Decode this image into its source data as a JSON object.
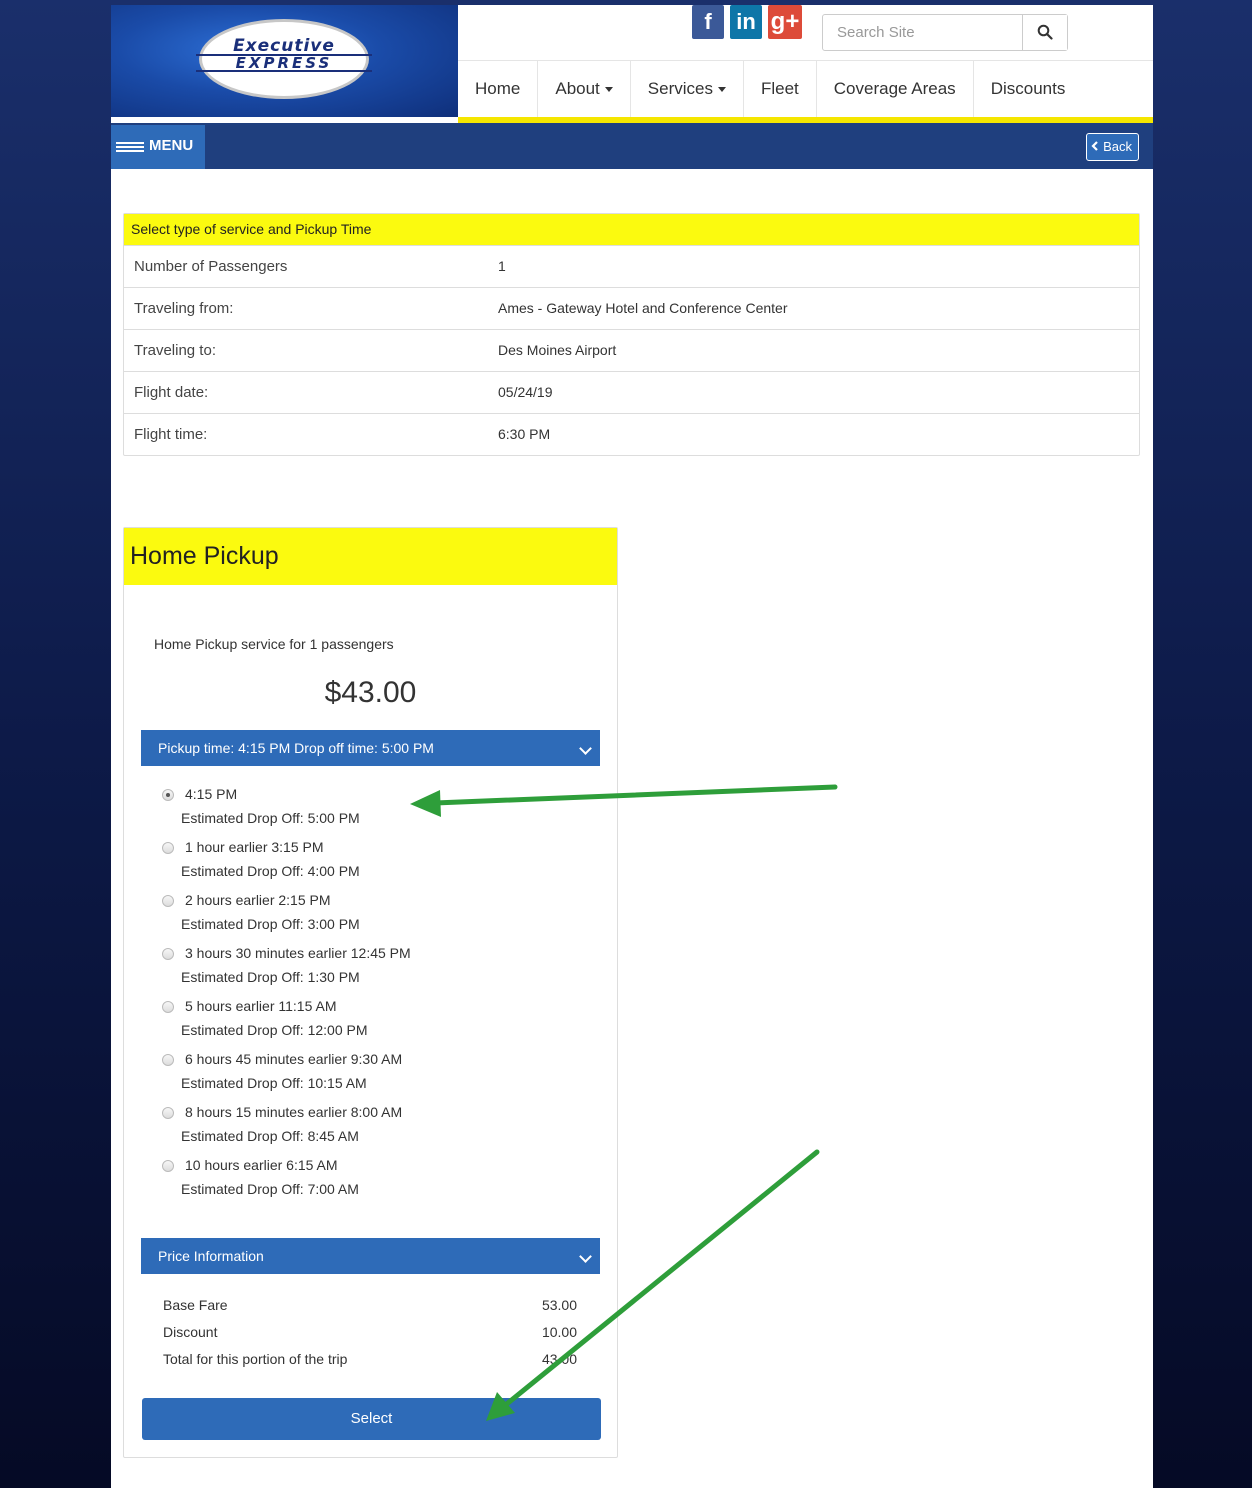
{
  "header": {
    "logo_line1": "Executive",
    "logo_line2": "EXPRESS",
    "social": {
      "facebook": "f",
      "linkedin": "in",
      "googleplus": "g+"
    },
    "search": {
      "placeholder": "Search Site",
      "value": ""
    },
    "nav": [
      {
        "label": "Home",
        "dropdown": false
      },
      {
        "label": "About",
        "dropdown": true
      },
      {
        "label": "Services",
        "dropdown": true
      },
      {
        "label": "Fleet",
        "dropdown": false
      },
      {
        "label": "Coverage Areas",
        "dropdown": false
      },
      {
        "label": "Discounts",
        "dropdown": false
      }
    ],
    "menu_label": "MENU",
    "back_label": "Back"
  },
  "summary": {
    "title": "Select type of service and Pickup Time",
    "rows": [
      {
        "label": "Number of Passengers",
        "value": "1"
      },
      {
        "label": "Traveling from:",
        "value": "Ames - Gateway Hotel and Conference Center"
      },
      {
        "label": "Traveling to:",
        "value": "Des Moines Airport"
      },
      {
        "label": "Flight date:",
        "value": "05/24/19"
      },
      {
        "label": "Flight time:",
        "value": "6:30 PM"
      }
    ]
  },
  "pickup": {
    "title": "Home Pickup",
    "description": "Home Pickup service for 1 passengers",
    "price": "$43.00",
    "time_panel_label": "Pickup time: 4:15 PM Drop off time: 5:00 PM",
    "options": [
      {
        "label": "4:15 PM",
        "dropoff": "Estimated Drop Off: 5:00 PM",
        "checked": true
      },
      {
        "label": "1 hour earlier 3:15 PM",
        "dropoff": "Estimated Drop Off: 4:00 PM",
        "checked": false
      },
      {
        "label": "2 hours earlier 2:15 PM",
        "dropoff": "Estimated Drop Off: 3:00 PM",
        "checked": false
      },
      {
        "label": "3 hours 30 minutes earlier 12:45 PM",
        "dropoff": "Estimated Drop Off: 1:30 PM",
        "checked": false
      },
      {
        "label": "5 hours earlier 11:15 AM",
        "dropoff": "Estimated Drop Off: 12:00 PM",
        "checked": false
      },
      {
        "label": "6 hours 45 minutes earlier 9:30 AM",
        "dropoff": "Estimated Drop Off: 10:15 AM",
        "checked": false
      },
      {
        "label": "8 hours 15 minutes earlier 8:00 AM",
        "dropoff": "Estimated Drop Off: 8:45 AM",
        "checked": false
      },
      {
        "label": "10 hours earlier 6:15 AM",
        "dropoff": "Estimated Drop Off: 7:00 AM",
        "checked": false
      }
    ],
    "price_panel_label": "Price Information",
    "price_rows": [
      {
        "label": "Base Fare",
        "value": "53.00"
      },
      {
        "label": "Discount",
        "value": "10.00"
      },
      {
        "label": "Total for this portion of the trip",
        "value": "43.00"
      }
    ],
    "select_label": "Select"
  },
  "colors": {
    "accent_yellow": "#fbfa0f",
    "primary_blue": "#2e6bb8",
    "nav_dark": "#1f3f7e",
    "annotation_arrow": "#2e9e3a"
  }
}
